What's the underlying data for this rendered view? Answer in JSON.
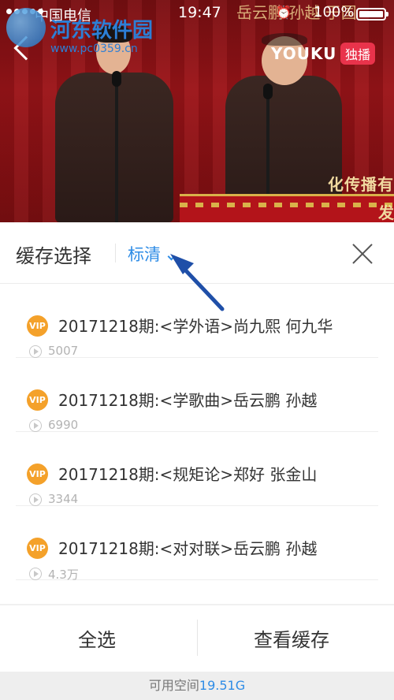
{
  "watermark": {
    "title": "河东软件园",
    "url": "www.pc0359.cn"
  },
  "status_bar": {
    "carrier": "中国电信",
    "time": "19:47",
    "battery": "100%"
  },
  "video": {
    "top_text": "岳云鹏 孙越 于国",
    "logo_text": "YOUKU",
    "exclusive_label": "独播",
    "banner_line1": "化传播有",
    "banner_line2": "发"
  },
  "panel": {
    "title": "缓存选择",
    "quality_label": "标清"
  },
  "episodes": [
    {
      "badge": "VIP",
      "title": "20171218期:<学外语>尚九熙 何九华",
      "play_count": "5007"
    },
    {
      "badge": "VIP",
      "title": "20171218期:<学歌曲>岳云鹏 孙越",
      "play_count": "6990"
    },
    {
      "badge": "VIP",
      "title": "20171218期:<规矩论>郑好 张金山",
      "play_count": "3344"
    },
    {
      "badge": "VIP",
      "title": "20171218期:<对对联>岳云鹏 孙越",
      "play_count": "4.3万"
    }
  ],
  "footer": {
    "select_all_label": "全选",
    "view_cache_label": "查看缓存",
    "storage_label": "可用空间",
    "storage_value": "19.51G"
  },
  "colors": {
    "accent": "#2e8ce6",
    "vip_badge": "#f4a12a",
    "annotation_arrow": "#1f4fa8"
  }
}
